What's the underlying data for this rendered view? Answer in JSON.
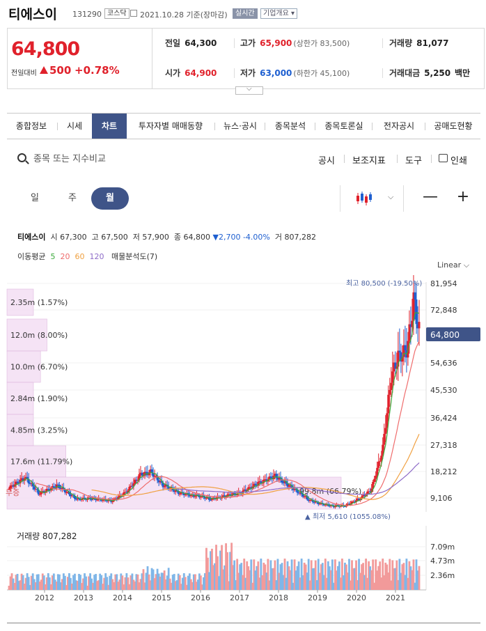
{
  "header": {
    "name": "티에스이",
    "code": "131290",
    "market": "코스닥",
    "date": "2021.10.28 기준(장마감)",
    "realtime": "실시간",
    "company_info": "기업개요 ▾"
  },
  "price": {
    "current": "64,800",
    "change_label": "전일대비",
    "change": "500",
    "change_pct": "+0.78%",
    "prev_label": "전일",
    "prev": "64,300",
    "high_label": "고가",
    "high": "65,900",
    "upper_limit": "(상한가 83,500)",
    "volume_label": "거래량",
    "volume": "81,077",
    "open_label": "시가",
    "open": "64,900",
    "low_label": "저가",
    "low": "63,000",
    "lower_limit": "(하한가 45,100)",
    "amount_label": "거래대금",
    "amount": "5,250",
    "amount_unit": "백만"
  },
  "tabs": [
    {
      "label": "종합정보"
    },
    {
      "label": "시세"
    },
    {
      "label": "차트"
    },
    {
      "label": "투자자별 매매동향"
    },
    {
      "label": "뉴스·공시"
    },
    {
      "label": "종목분석"
    },
    {
      "label": "종목토론실"
    },
    {
      "label": "전자공시"
    },
    {
      "label": "공매도현황"
    }
  ],
  "toolbar": {
    "search_placeholder": "종목 또는 지수비교",
    "disclosure": "공시",
    "indicators": "보조지표",
    "tools": "도구",
    "print": "인쇄"
  },
  "periods": {
    "day": "일",
    "week": "주",
    "month": "월"
  },
  "legend": {
    "name": "티에스이",
    "open_label": "시",
    "open": "67,300",
    "high_label": "고",
    "high": "67,500",
    "low_label": "저",
    "low": "57,900",
    "close_label": "종",
    "close": "64,800",
    "change": "2,700 -4.00%",
    "vol_label": "거",
    "vol": "807,282",
    "ma_label": "이동평균",
    "ma5": "5",
    "ma20": "20",
    "ma60": "60",
    "ma120": "120",
    "vp_label": "매물분석도(7)",
    "scale": "Linear"
  },
  "colors": {
    "up": "#e0212b",
    "down": "#1e5fd0",
    "accent": "#3f5488",
    "ma5": "#3caa3c",
    "ma20": "#ef6c6c",
    "ma60": "#f0a040",
    "ma120": "#8e6cc8",
    "profile": "#f3def3",
    "volume_up": "#f29a9a",
    "volume_down": "#7fb6e8"
  },
  "chart_data": {
    "type": "candlestick",
    "x_ticks": [
      "2012",
      "2013",
      "2014",
      "2015",
      "2016",
      "2017",
      "2018",
      "2019",
      "2020",
      "2021"
    ],
    "y_ticks": [
      "81,954",
      "72,848",
      "54,636",
      "45,530",
      "36,424",
      "27,318",
      "18,212",
      "9,106"
    ],
    "current_label": "64,800",
    "high_annotation": "최고 80,500 (-19.50%)",
    "low_annotation": "▲ 최저 5,610 (1055.08%)",
    "volume_profile": [
      {
        "label": "2.35m (1.57%)",
        "pct": 1.57
      },
      {
        "label": "12.0m (8.00%)",
        "pct": 8.0
      },
      {
        "label": "10.0m (6.70%)",
        "pct": 6.7
      },
      {
        "label": "2.84m (1.90%)",
        "pct": 1.9
      },
      {
        "label": "4.85m (3.25%)",
        "pct": 3.25
      },
      {
        "label": "17.6m (11.79%)",
        "pct": 11.79
      },
      {
        "label": "99.8m (66.79%)",
        "pct": 66.79
      }
    ],
    "profile_side_label": "무증",
    "volume_title": "거래량 807,282",
    "volume_ticks": [
      "7.09m",
      "4.73m",
      "2.36m"
    ]
  }
}
